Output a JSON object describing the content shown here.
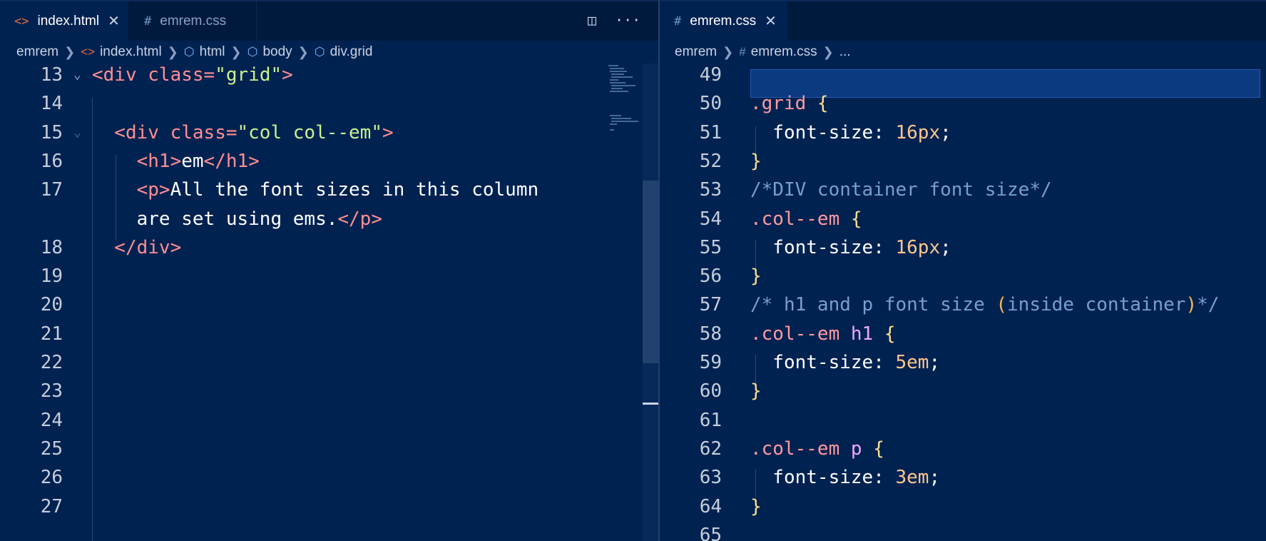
{
  "left": {
    "tabs": [
      {
        "icon": "<>",
        "label": "index.html",
        "close": "✕"
      },
      {
        "icon": "#",
        "label": "emrem.css"
      }
    ],
    "actions": {
      "split": "◫",
      "more": "···"
    },
    "breadcrumb": [
      "emrem",
      "index.html",
      "html",
      "body",
      "div.grid"
    ],
    "lines": [
      {
        "n": "13",
        "tokens": [
          {
            "t": "<div ",
            "c": "t-tag"
          },
          {
            "t": "class=",
            "c": "t-attr"
          },
          {
            "t": "\"grid\"",
            "c": "t-str"
          },
          {
            "t": ">",
            "c": "t-tag"
          }
        ]
      },
      {
        "n": "14",
        "tokens": []
      },
      {
        "n": "15",
        "tokens": [
          {
            "t": "  <div ",
            "c": "t-tag"
          },
          {
            "t": "class=",
            "c": "t-attr"
          },
          {
            "t": "\"col col--em\"",
            "c": "t-str"
          },
          {
            "t": ">",
            "c": "t-tag"
          }
        ]
      },
      {
        "n": "16",
        "tokens": [
          {
            "t": "    <h1>",
            "c": "t-tag"
          },
          {
            "t": "em",
            "c": "t-txt"
          },
          {
            "t": "</h1>",
            "c": "t-tag"
          }
        ]
      },
      {
        "n": "17",
        "tokens": [
          {
            "t": "    <p>",
            "c": "t-tag"
          },
          {
            "t": "All the font sizes in this column",
            "c": "t-txt"
          }
        ]
      },
      {
        "n": "",
        "tokens": [
          {
            "t": "    are set using ems.",
            "c": "t-txt"
          },
          {
            "t": "</p>",
            "c": "t-tag"
          }
        ]
      },
      {
        "n": "18",
        "tokens": [
          {
            "t": "  </div>",
            "c": "t-tag"
          }
        ]
      },
      {
        "n": "19",
        "tokens": []
      },
      {
        "n": "20",
        "tokens": []
      },
      {
        "n": "21",
        "tokens": []
      },
      {
        "n": "22",
        "tokens": []
      },
      {
        "n": "23",
        "tokens": []
      },
      {
        "n": "24",
        "tokens": []
      },
      {
        "n": "25",
        "tokens": []
      },
      {
        "n": "26",
        "tokens": []
      },
      {
        "n": "27",
        "tokens": []
      }
    ]
  },
  "right": {
    "tabs": [
      {
        "icon": "#",
        "label": "emrem.css",
        "close": "✕"
      }
    ],
    "breadcrumb": [
      "emrem",
      "emrem.css",
      "..."
    ],
    "lines": [
      {
        "n": "49",
        "tokens": []
      },
      {
        "n": "50",
        "tokens": [
          {
            "t": ".grid ",
            "c": "t-sel"
          },
          {
            "t": "{",
            "c": "t-brace"
          }
        ]
      },
      {
        "n": "51",
        "tokens": [
          {
            "t": "  font-size",
            "c": "t-prop"
          },
          {
            "t": ": ",
            "c": "t-prop"
          },
          {
            "t": "16px",
            "c": "t-num"
          },
          {
            "t": ";",
            "c": "t-prop"
          }
        ]
      },
      {
        "n": "52",
        "tokens": [
          {
            "t": "}",
            "c": "t-brace"
          }
        ]
      },
      {
        "n": "53",
        "tokens": [
          {
            "t": "/*DIV container font size*/",
            "c": "t-com"
          }
        ]
      },
      {
        "n": "54",
        "tokens": [
          {
            "t": ".col--em ",
            "c": "t-sel"
          },
          {
            "t": "{",
            "c": "t-brace"
          }
        ]
      },
      {
        "n": "55",
        "tokens": [
          {
            "t": "  font-size",
            "c": "t-prop"
          },
          {
            "t": ": ",
            "c": "t-prop"
          },
          {
            "t": "16px",
            "c": "t-num"
          },
          {
            "t": ";",
            "c": "t-prop"
          }
        ]
      },
      {
        "n": "56",
        "tokens": [
          {
            "t": "}",
            "c": "t-brace"
          }
        ]
      },
      {
        "n": "57",
        "tokens": [
          {
            "t": "/* h1 and p font size ",
            "c": "t-com"
          },
          {
            "t": "(",
            "c": "t-par"
          },
          {
            "t": "inside container",
            "c": "t-com"
          },
          {
            "t": ")",
            "c": "t-par"
          },
          {
            "t": "*/",
            "c": "t-com"
          }
        ]
      },
      {
        "n": "58",
        "tokens": [
          {
            "t": ".col--em ",
            "c": "t-sel"
          },
          {
            "t": "h1 ",
            "c": "t-el"
          },
          {
            "t": "{",
            "c": "t-brace"
          }
        ]
      },
      {
        "n": "59",
        "tokens": [
          {
            "t": "  font-size",
            "c": "t-prop"
          },
          {
            "t": ": ",
            "c": "t-prop"
          },
          {
            "t": "5em",
            "c": "t-num"
          },
          {
            "t": ";",
            "c": "t-prop"
          }
        ]
      },
      {
        "n": "60",
        "tokens": [
          {
            "t": "}",
            "c": "t-brace"
          }
        ]
      },
      {
        "n": "61",
        "tokens": []
      },
      {
        "n": "62",
        "tokens": [
          {
            "t": ".col--em ",
            "c": "t-sel"
          },
          {
            "t": "p ",
            "c": "t-el"
          },
          {
            "t": "{",
            "c": "t-brace"
          }
        ]
      },
      {
        "n": "63",
        "tokens": [
          {
            "t": "  font-size",
            "c": "t-prop"
          },
          {
            "t": ": ",
            "c": "t-prop"
          },
          {
            "t": "3em",
            "c": "t-num"
          },
          {
            "t": ";",
            "c": "t-prop"
          }
        ]
      },
      {
        "n": "64",
        "tokens": [
          {
            "t": "}",
            "c": "t-brace"
          }
        ]
      },
      {
        "n": "65",
        "tokens": []
      }
    ]
  }
}
